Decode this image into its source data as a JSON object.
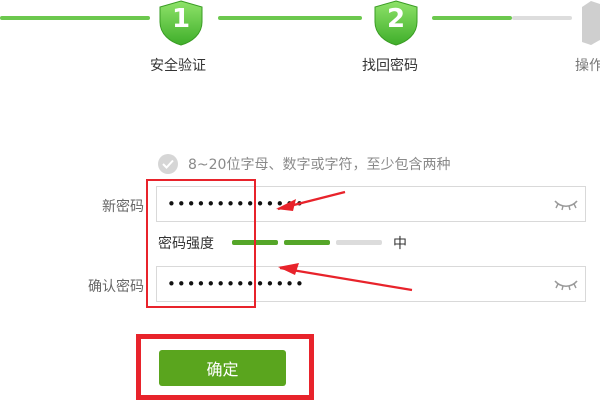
{
  "steps": [
    {
      "number": "1",
      "label": "安全验证"
    },
    {
      "number": "2",
      "label": "找回密码"
    },
    {
      "number": "",
      "label": "操作"
    }
  ],
  "password_hint": "8~20位字母、数字或字符，至少包含两种",
  "new_password": {
    "label": "新密码",
    "value": "••••••••••••••"
  },
  "strength": {
    "label": "密码强度",
    "level_text": "中",
    "level": 2,
    "max": 3
  },
  "confirm_password": {
    "label": "确认密码",
    "value": "••••••••••••••"
  },
  "confirm_button": {
    "label": "确定"
  },
  "icons": {
    "check": "check-circle-icon",
    "eye": "eye-closed-icon",
    "shield": "shield-icon"
  },
  "colors": {
    "accent": "#5aa51e",
    "annotation": "#e8232b",
    "track": "#6cc84e"
  }
}
